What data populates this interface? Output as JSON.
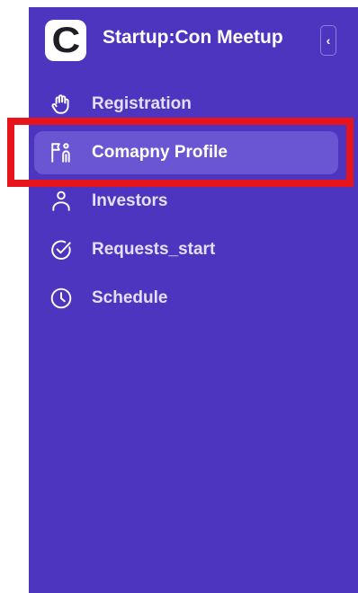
{
  "app": {
    "logo_letter": "C",
    "title": "Startup:Con Meetup",
    "collapse_glyph": "‹"
  },
  "nav": {
    "items": [
      {
        "label": "Registration",
        "icon": "hand-icon",
        "active": false
      },
      {
        "label": "Comapny Profile",
        "icon": "flag-person-icon",
        "active": true
      },
      {
        "label": "Investors",
        "icon": "person-icon",
        "active": false
      },
      {
        "label": "Requests_start",
        "icon": "check-circle-icon",
        "active": false
      },
      {
        "label": "Schedule",
        "icon": "clock-icon",
        "active": false
      }
    ]
  },
  "colors": {
    "sidebar_bg": "#4e35c0",
    "active_item_bg": "#6a56d2",
    "highlight_border": "#e8141b"
  }
}
